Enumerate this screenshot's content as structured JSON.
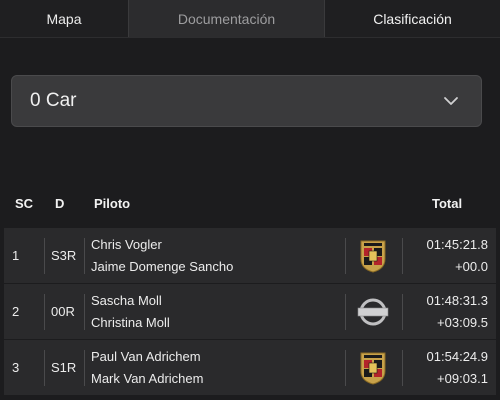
{
  "tabs": [
    {
      "label": "Mapa"
    },
    {
      "label": "Documentación"
    },
    {
      "label": "Clasificación"
    }
  ],
  "filter": {
    "selected": "0 Car"
  },
  "table": {
    "headers": {
      "sc": "SC",
      "d": "D",
      "piloto": "Piloto",
      "total": "Total"
    },
    "rows": [
      {
        "position": "1",
        "class": "S3R",
        "driver1": "Chris Vogler",
        "driver2": "Jaime Domenge Sancho",
        "brand": "porsche-logo",
        "time": "01:45:21.8",
        "gap": "+00.0"
      },
      {
        "position": "2",
        "class": "00R",
        "driver1": "Sascha Moll",
        "driver2": "Christina Moll",
        "brand": "nissan-logo",
        "time": "01:48:31.3",
        "gap": "+03:09.5"
      },
      {
        "position": "3",
        "class": "S1R",
        "driver1": "Paul Van Adrichem",
        "driver2": "Mark Van Adrichem",
        "brand": "porsche-logo",
        "time": "01:54:24.9",
        "gap": "+09:03.1"
      }
    ]
  },
  "colors": {
    "background": "#1c1c1e",
    "row": "#2a2a2c",
    "dropdown": "#3a3a3c"
  }
}
